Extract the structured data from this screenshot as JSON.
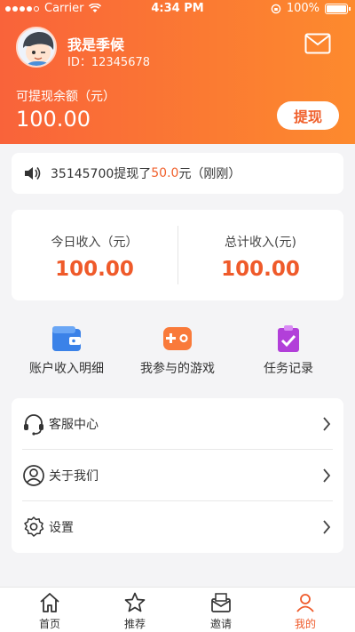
{
  "status_bar": {
    "carrier": "Carrier",
    "time": "4:34 PM",
    "battery": "100%"
  },
  "profile": {
    "name": "我是季候",
    "id": "ID：12345678"
  },
  "balance": {
    "label": "可提现余额（元）",
    "value": "100.00",
    "withdraw_label": "提现"
  },
  "notice": {
    "prefix": "35145700提现了",
    "amount": "50.0",
    "suffix": "元（刚刚）"
  },
  "income": {
    "today_label": "今日收入（元）",
    "today_value": "100.00",
    "total_label": "总计收入(元)",
    "total_value": "100.00"
  },
  "features": [
    {
      "label": "账户收入明细",
      "icon": "wallet-icon"
    },
    {
      "label": "我参与的游戏",
      "icon": "gamepad-icon"
    },
    {
      "label": "任务记录",
      "icon": "clipboard-check-icon"
    }
  ],
  "menu": [
    {
      "label": "客服中心",
      "icon": "headset-icon"
    },
    {
      "label": "关于我们",
      "icon": "user-icon"
    },
    {
      "label": "设置",
      "icon": "gear-icon"
    }
  ],
  "tabs": [
    {
      "label": "首页",
      "icon": "home-icon"
    },
    {
      "label": "推荐",
      "icon": "star-icon"
    },
    {
      "label": "邀请",
      "icon": "envelope-icon"
    },
    {
      "label": "我的",
      "icon": "profile-icon"
    }
  ],
  "colors": {
    "accent": "#f0602c",
    "header_start": "#f9633a",
    "header_end": "#fd8a2e"
  }
}
